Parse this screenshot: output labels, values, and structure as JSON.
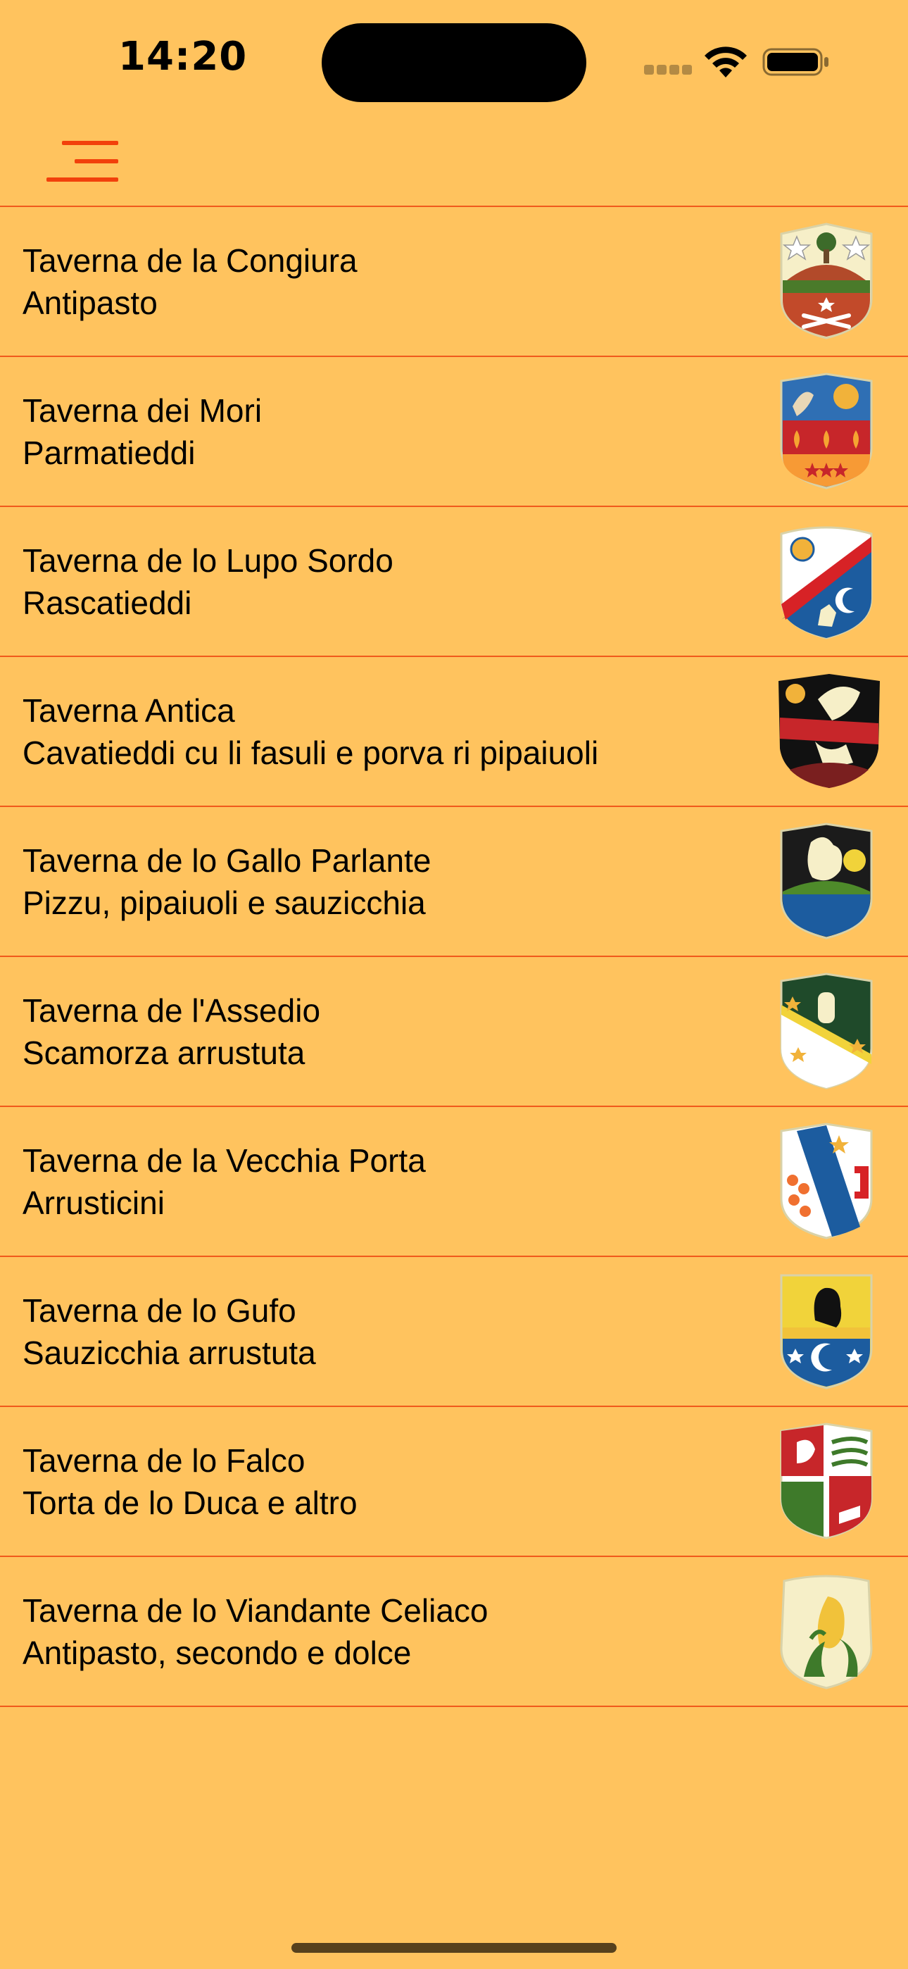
{
  "status_bar": {
    "time": "14:20",
    "icons": [
      "cellular-signal-icon",
      "wifi-icon",
      "battery-icon"
    ]
  },
  "navbar": {
    "menu_icon": "hamburger-menu-icon",
    "accent_color": "#F2400B"
  },
  "colors": {
    "background": "#FFC35E",
    "divider": "#F0591C"
  },
  "taverns": [
    {
      "name": "Taverna de la Congiura",
      "dish": "Antipasto",
      "crest": "congiura-crest-icon"
    },
    {
      "name": "Taverna dei Mori",
      "dish": "Parmatieddi",
      "crest": "mori-crest-icon"
    },
    {
      "name": "Taverna de lo Lupo Sordo",
      "dish": "Rascatieddi",
      "crest": "lupo-sordo-crest-icon"
    },
    {
      "name": "Taverna Antica",
      "dish": "Cavatieddi cu li fasuli e porva ri pipaiuoli",
      "crest": "antica-crest-icon"
    },
    {
      "name": "Taverna de lo Gallo Parlante",
      "dish": "Pizzu, pipaiuoli e sauzicchia",
      "crest": "gallo-parlante-crest-icon"
    },
    {
      "name": "Taverna de l'Assedio",
      "dish": "Scamorza arrustuta",
      "crest": "assedio-crest-icon"
    },
    {
      "name": "Taverna de la Vecchia Porta",
      "dish": "Arrusticini",
      "crest": "vecchia-porta-crest-icon"
    },
    {
      "name": "Taverna de lo Gufo",
      "dish": "Sauzicchia arrustuta",
      "crest": "gufo-crest-icon"
    },
    {
      "name": "Taverna de lo Falco",
      "dish": "Torta de lo Duca e altro",
      "crest": "falco-crest-icon"
    },
    {
      "name": "Taverna de lo Viandante Celiaco",
      "dish": "Antipasto, secondo e dolce",
      "crest": "viandante-celiaco-crest-icon"
    }
  ]
}
